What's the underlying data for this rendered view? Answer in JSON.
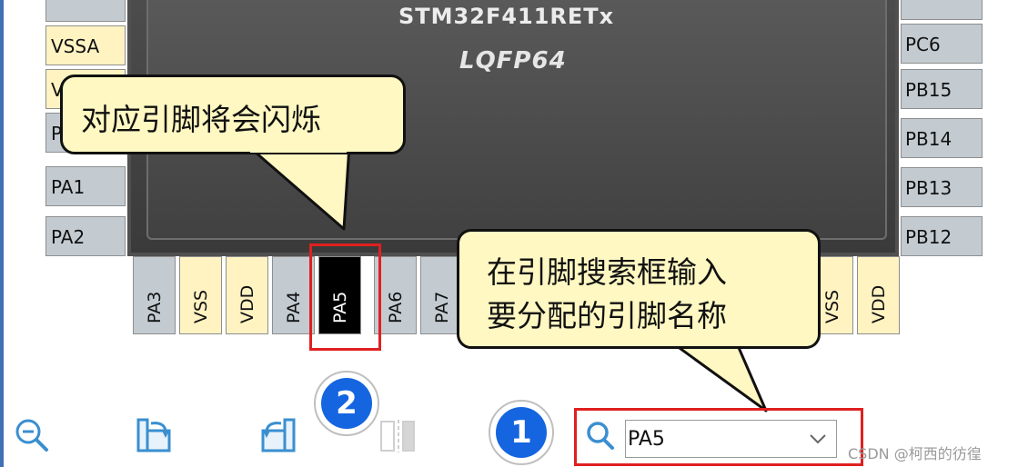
{
  "chip": {
    "part": "STM32F411RETx",
    "package": "LQFP64"
  },
  "pins_left": [
    {
      "label": "VSSA",
      "kind": "power"
    },
    {
      "label": "V",
      "kind": "power"
    },
    {
      "label": "P",
      "kind": "io"
    },
    {
      "label": "PA1",
      "kind": "io"
    },
    {
      "label": "PA2",
      "kind": "io"
    }
  ],
  "pins_right": [
    {
      "label": "PC6",
      "kind": "io"
    },
    {
      "label": "PB15",
      "kind": "io"
    },
    {
      "label": "PB14",
      "kind": "io"
    },
    {
      "label": "PB13",
      "kind": "io"
    },
    {
      "label": "PB12",
      "kind": "io"
    }
  ],
  "pins_bottom": [
    {
      "label": "PA3",
      "kind": "io"
    },
    {
      "label": "VSS",
      "kind": "power"
    },
    {
      "label": "VDD",
      "kind": "power"
    },
    {
      "label": "PA4",
      "kind": "io"
    },
    {
      "label": "PA5",
      "kind": "selected"
    },
    {
      "label": "PA6",
      "kind": "io"
    },
    {
      "label": "PA7",
      "kind": "io"
    },
    {
      "label": "VSS",
      "kind": "power"
    },
    {
      "label": "VDD",
      "kind": "power"
    }
  ],
  "callouts": {
    "pin_flash": "对应引脚将会闪烁",
    "search_line1": "在引脚搜索框输入",
    "search_line2": "要分配的引脚名称"
  },
  "badges": {
    "one": "1",
    "two": "2"
  },
  "toolbar": {
    "zoom_out_icon": "zoom-out-icon",
    "rotate_right_icon": "rotate-clockwise-icon",
    "rotate_left_icon": "rotate-counterclockwise-icon",
    "split_icon": "split-view-icon"
  },
  "search": {
    "value": "PA5",
    "icon": "search-icon"
  },
  "watermark": "CSDN @柯西的彷徨",
  "colors": {
    "highlight": "#e02020",
    "badge": "#1565e0",
    "callout_bg": "#fff8c2",
    "io_pin": "#c3cbd1",
    "power_pin": "#fff3c2"
  }
}
